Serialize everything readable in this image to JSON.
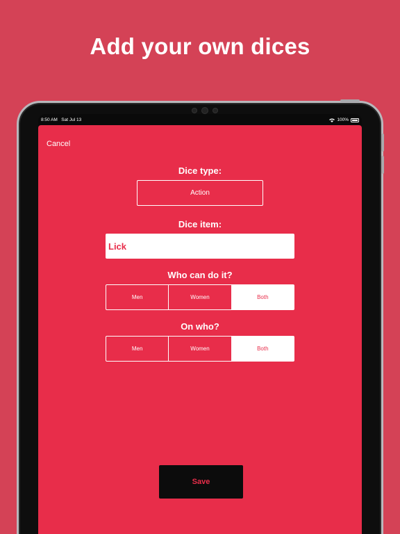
{
  "promo": {
    "headline": "Add your own dices"
  },
  "status_bar": {
    "time": "8:50 AM",
    "date": "Sat Jul 13",
    "battery": "100%"
  },
  "nav": {
    "cancel_label": "Cancel"
  },
  "form": {
    "dice_type": {
      "label": "Dice type:",
      "value": "Action"
    },
    "dice_item": {
      "label": "Dice item:",
      "value": "Lick"
    },
    "who_can": {
      "label": "Who can do it?",
      "options": [
        "Men",
        "Women",
        "Both"
      ],
      "selected": "Both"
    },
    "on_who": {
      "label": "On who?",
      "options": [
        "Men",
        "Women",
        "Both"
      ],
      "selected": "Both"
    }
  },
  "actions": {
    "save_label": "Save"
  },
  "colors": {
    "page_bg": "#d44256",
    "app_bg": "#e82d4a",
    "accent": "#e82d4a",
    "save_bg": "#0c0c0c"
  }
}
